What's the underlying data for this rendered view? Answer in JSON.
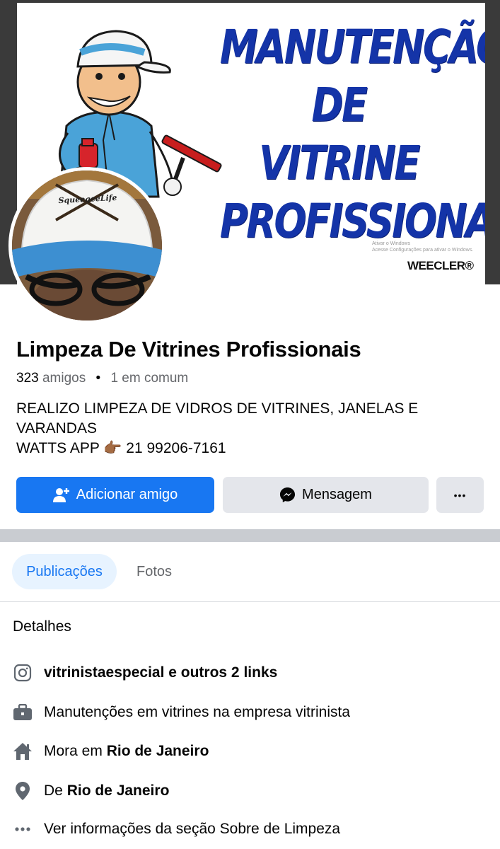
{
  "cover": {
    "title_lines": [
      "MANUTENÇÃO",
      "DE",
      "VITRINE",
      "PROFISSIONAL"
    ],
    "brand": "WEECLER®",
    "watermark_line1": "Ativar o Windows",
    "watermark_line2": "Acesse Configurações para ativar o Windows."
  },
  "avatar": {
    "cap_text": "SqueegeeLife"
  },
  "profile": {
    "name": "Limpeza De Vitrines Profissionais",
    "friends_count": "323",
    "friends_label": "amigos",
    "mutual": "1 em comum",
    "bio_lines": [
      "REALIZO LIMPEZA DE VIDROS DE VITRINES, JANELAS E",
      "VARANDAS",
      "WATTS APP 👉🏾  21 99206-7161"
    ]
  },
  "actions": {
    "add_friend": "Adicionar amigo",
    "message": "Mensagem",
    "more": "•••"
  },
  "tabs": {
    "posts": "Publicações",
    "photos": "Fotos"
  },
  "details": {
    "title": "Detalhes",
    "links": "vitrinistaespecial e outros 2 links",
    "work": "Manutenções em vitrines na empresa vitrinista",
    "lives_prefix": "Mora em ",
    "lives_city": "Rio de Janeiro",
    "from_prefix": "De ",
    "from_city": "Rio de Janeiro",
    "see_about": "Ver informações da seção Sobre de Limpeza"
  },
  "colors": {
    "accent": "#1877f2",
    "cover_text": "#1434a8",
    "button_gray": "#e4e6eb",
    "secondary_text": "#65676b"
  }
}
